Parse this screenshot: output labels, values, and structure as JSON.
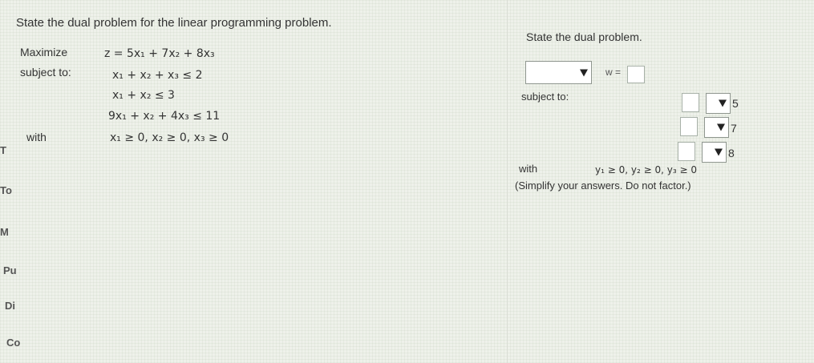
{
  "left_panel": {
    "title": "State the dual problem for the linear programming problem.",
    "maximize_label": "Maximize",
    "subject_to_label": "subject to:",
    "with_label": "with",
    "objective": "z = 5x₁ + 7x₂ + 8x₃",
    "constraints": [
      "x₁ + x₂ + x₃ ≤ 2",
      "x₁ + x₂ ≤ 3",
      "9x₁ + x₂ + 4x₃ ≤ 11"
    ],
    "nonnegativity": "x₁ ≥ 0,  x₂ ≥ 0,  x₃ ≥ 0"
  },
  "left_strip_fragments": [
    "T",
    "To",
    "M",
    "Pu",
    "Di",
    "Co"
  ],
  "right_panel": {
    "title": "State the dual problem.",
    "objective_var": "w =",
    "subject_to_label": "subject to:",
    "constraint_rhs": [
      "5",
      "7",
      "8"
    ],
    "with_label": "with",
    "nonnegativity": "y₁ ≥ 0,  y₂ ≥ 0,  y₃ ≥ 0",
    "hint": "(Simplify your answers. Do not factor.)"
  }
}
